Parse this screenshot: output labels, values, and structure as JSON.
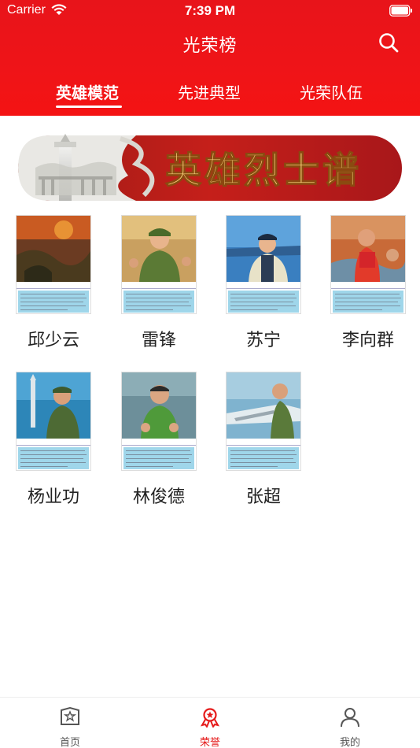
{
  "status_bar": {
    "carrier": "Carrier",
    "time": "7:39 PM"
  },
  "nav": {
    "title": "光荣榜"
  },
  "tabs": [
    {
      "label": "英雄模范",
      "active": true
    },
    {
      "label": "先进典型",
      "active": false
    },
    {
      "label": "光荣队伍",
      "active": false
    }
  ],
  "banner": {
    "title": "英雄烈士谱"
  },
  "heroes": [
    {
      "name": "邱少云"
    },
    {
      "name": "雷锋"
    },
    {
      "name": "苏宁"
    },
    {
      "name": "李向群"
    },
    {
      "name": "杨业功"
    },
    {
      "name": "林俊德"
    },
    {
      "name": "张超"
    }
  ],
  "tabbar": [
    {
      "label": "首页",
      "icon": "home-icon",
      "active": false
    },
    {
      "label": "荣誉",
      "icon": "honor-icon",
      "active": true
    },
    {
      "label": "我的",
      "icon": "profile-icon",
      "active": false
    }
  ],
  "colors": {
    "brand_red": "#e8141a",
    "active_tab": "#e51b1b",
    "banner_gold": "#f7d27a"
  }
}
